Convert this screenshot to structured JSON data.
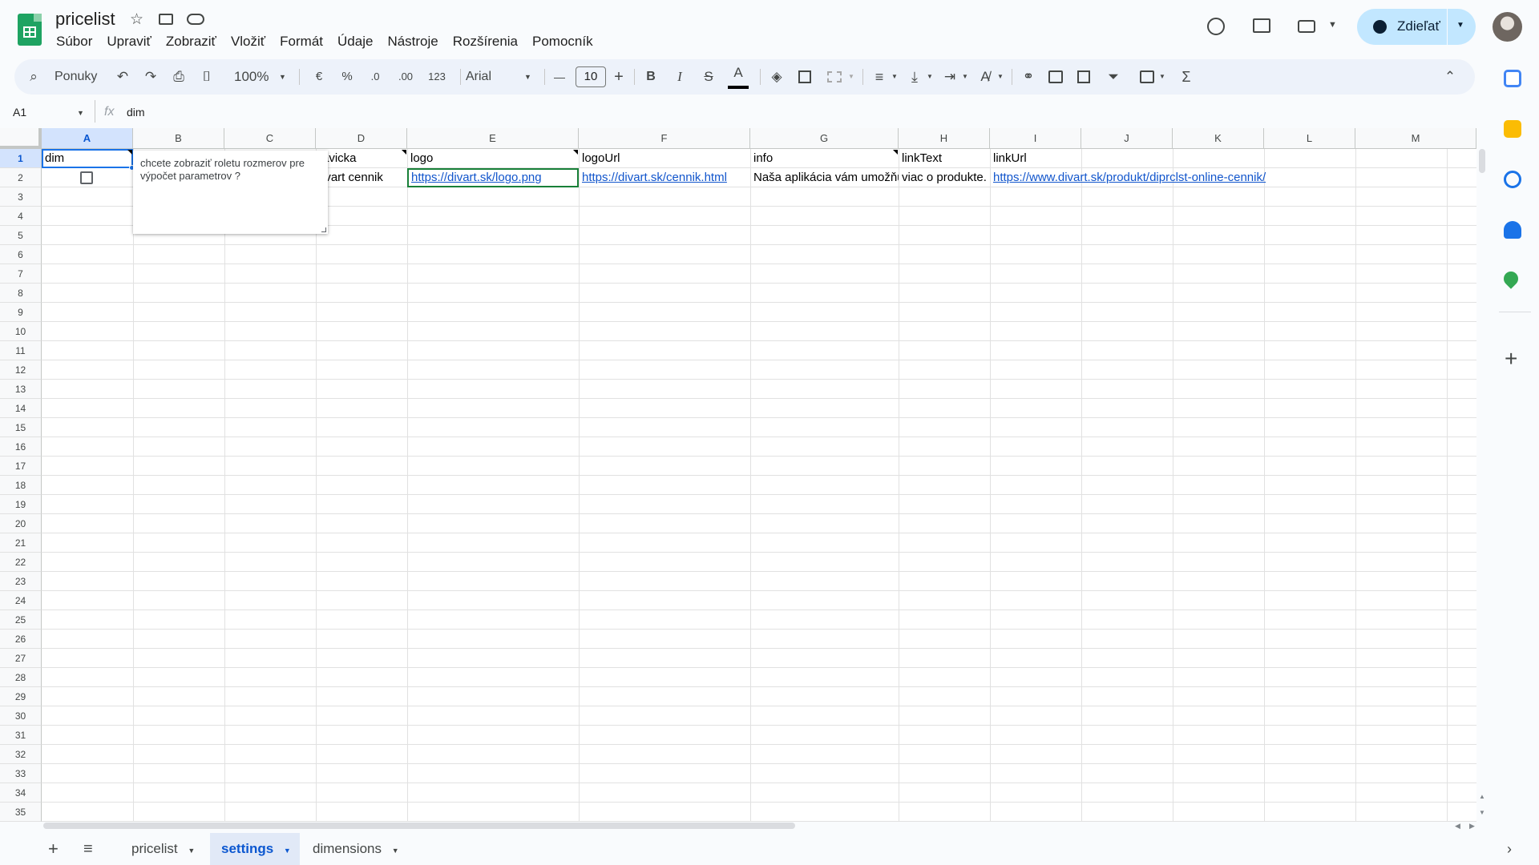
{
  "doc": {
    "title": "pricelist"
  },
  "menu": [
    "Súbor",
    "Upraviť",
    "Zobraziť",
    "Vložiť",
    "Formát",
    "Údaje",
    "Nástroje",
    "Rozšírenia",
    "Pomocník"
  ],
  "share": {
    "label": "Zdieľať"
  },
  "toolbar": {
    "search": "Ponuky",
    "zoom": "100%",
    "currency": "€",
    "percent": "%",
    "dec_minus": ".0",
    "dec_plus": ".00",
    "format_123": "123",
    "font": "Arial",
    "font_size": "10",
    "minus": "—",
    "plus": "+",
    "bold": "B",
    "italic": "I",
    "strike": "S",
    "text_color": "A",
    "sum": "Σ"
  },
  "formula_bar": {
    "cell_ref": "A1",
    "fx": "fx",
    "value": "dim"
  },
  "columns": [
    "A",
    "B",
    "C",
    "D",
    "E",
    "F",
    "G",
    "H",
    "I",
    "J",
    "K",
    "L",
    "M"
  ],
  "rows": [
    "1",
    "2",
    "3",
    "4",
    "5",
    "6",
    "7",
    "8",
    "9",
    "10",
    "11",
    "12",
    "13",
    "14",
    "15",
    "16",
    "17",
    "18",
    "19",
    "20",
    "21",
    "22",
    "23",
    "24",
    "25",
    "26",
    "27",
    "28",
    "29",
    "30",
    "31",
    "32",
    "33",
    "34",
    "35"
  ],
  "cells": {
    "A1": "dim",
    "D1": "avicka",
    "E1": "logo",
    "F1": "logoUrl",
    "G1": "info",
    "H1": "linkText",
    "I1": "linkUrl",
    "D2": "ivart cennik",
    "E2": "https://divart.sk/logo.png",
    "F2": "https://divart.sk/cennik.html",
    "G2": "Naša aplikácia vám umožňu",
    "H2": "viac o produkte.",
    "I2": "https://www.divart.sk/produkt/diprclst-online-cennik/"
  },
  "note": {
    "text": "chcete zobraziť roletu rozmerov pre výpočet parametrov ?"
  },
  "sheets": [
    {
      "name": "pricelist"
    },
    {
      "name": "settings"
    },
    {
      "name": "dimensions"
    }
  ],
  "colors": {
    "accent": "#0b57d0",
    "share_bg": "#c2e7ff",
    "selection": "#1a73e8",
    "link": "#1155cc"
  }
}
